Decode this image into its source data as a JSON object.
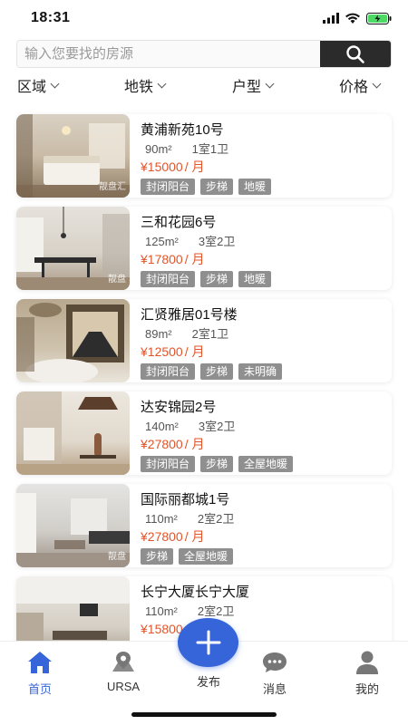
{
  "status": {
    "time": "18:31"
  },
  "search": {
    "placeholder": "输入您要找的房源",
    "icon": "search-icon"
  },
  "filters": [
    {
      "label": "区域"
    },
    {
      "label": "地铁"
    },
    {
      "label": "户型"
    },
    {
      "label": "价格"
    }
  ],
  "listings": [
    {
      "title": "黄浦新苑10号",
      "area": "90m²",
      "layout": "1室1卫",
      "price": "¥15000",
      "unit": "/ 月",
      "tags": [
        "封闭阳台",
        "步梯",
        "地暖"
      ],
      "watermark": "靓盘汇"
    },
    {
      "title": "三和花园6号",
      "area": "125m²",
      "layout": "3室2卫",
      "price": "¥17800",
      "unit": "/ 月",
      "tags": [
        "封闭阳台",
        "步梯",
        "地暖"
      ],
      "watermark": "靓盘"
    },
    {
      "title": "汇贤雅居01号楼",
      "area": "89m²",
      "layout": "2室1卫",
      "price": "¥12500",
      "unit": "/ 月",
      "tags": [
        "封闭阳台",
        "步梯",
        "未明确"
      ],
      "watermark": ""
    },
    {
      "title": "达安锦园2号",
      "area": "140m²",
      "layout": "3室2卫",
      "price": "¥27800",
      "unit": "/ 月",
      "tags": [
        "封闭阳台",
        "步梯",
        "全屋地暖"
      ],
      "watermark": ""
    },
    {
      "title": "国际丽都城1号",
      "area": "110m²",
      "layout": "2室2卫",
      "price": "¥27800",
      "unit": "/ 月",
      "tags": [
        "步梯",
        "全屋地暖"
      ],
      "watermark": "靓盘"
    },
    {
      "title": "长宁大厦长宁大厦",
      "area": "110m²",
      "layout": "2室2卫",
      "price": "¥15800",
      "unit": "",
      "tags": [],
      "watermark": ""
    }
  ],
  "tabbar": {
    "items": [
      {
        "label": "首页",
        "icon": "home-icon",
        "active": true
      },
      {
        "label": "URSA",
        "icon": "location-pin-icon",
        "active": false
      },
      {
        "label": "发布",
        "icon": "plus-icon",
        "active": false
      },
      {
        "label": "消息",
        "icon": "chat-bubble-icon",
        "active": false
      },
      {
        "label": "我的",
        "icon": "user-icon",
        "active": false
      }
    ]
  },
  "colors": {
    "accent": "#3565d9",
    "price": "#e2552a",
    "tag": "#8f8f8f"
  }
}
